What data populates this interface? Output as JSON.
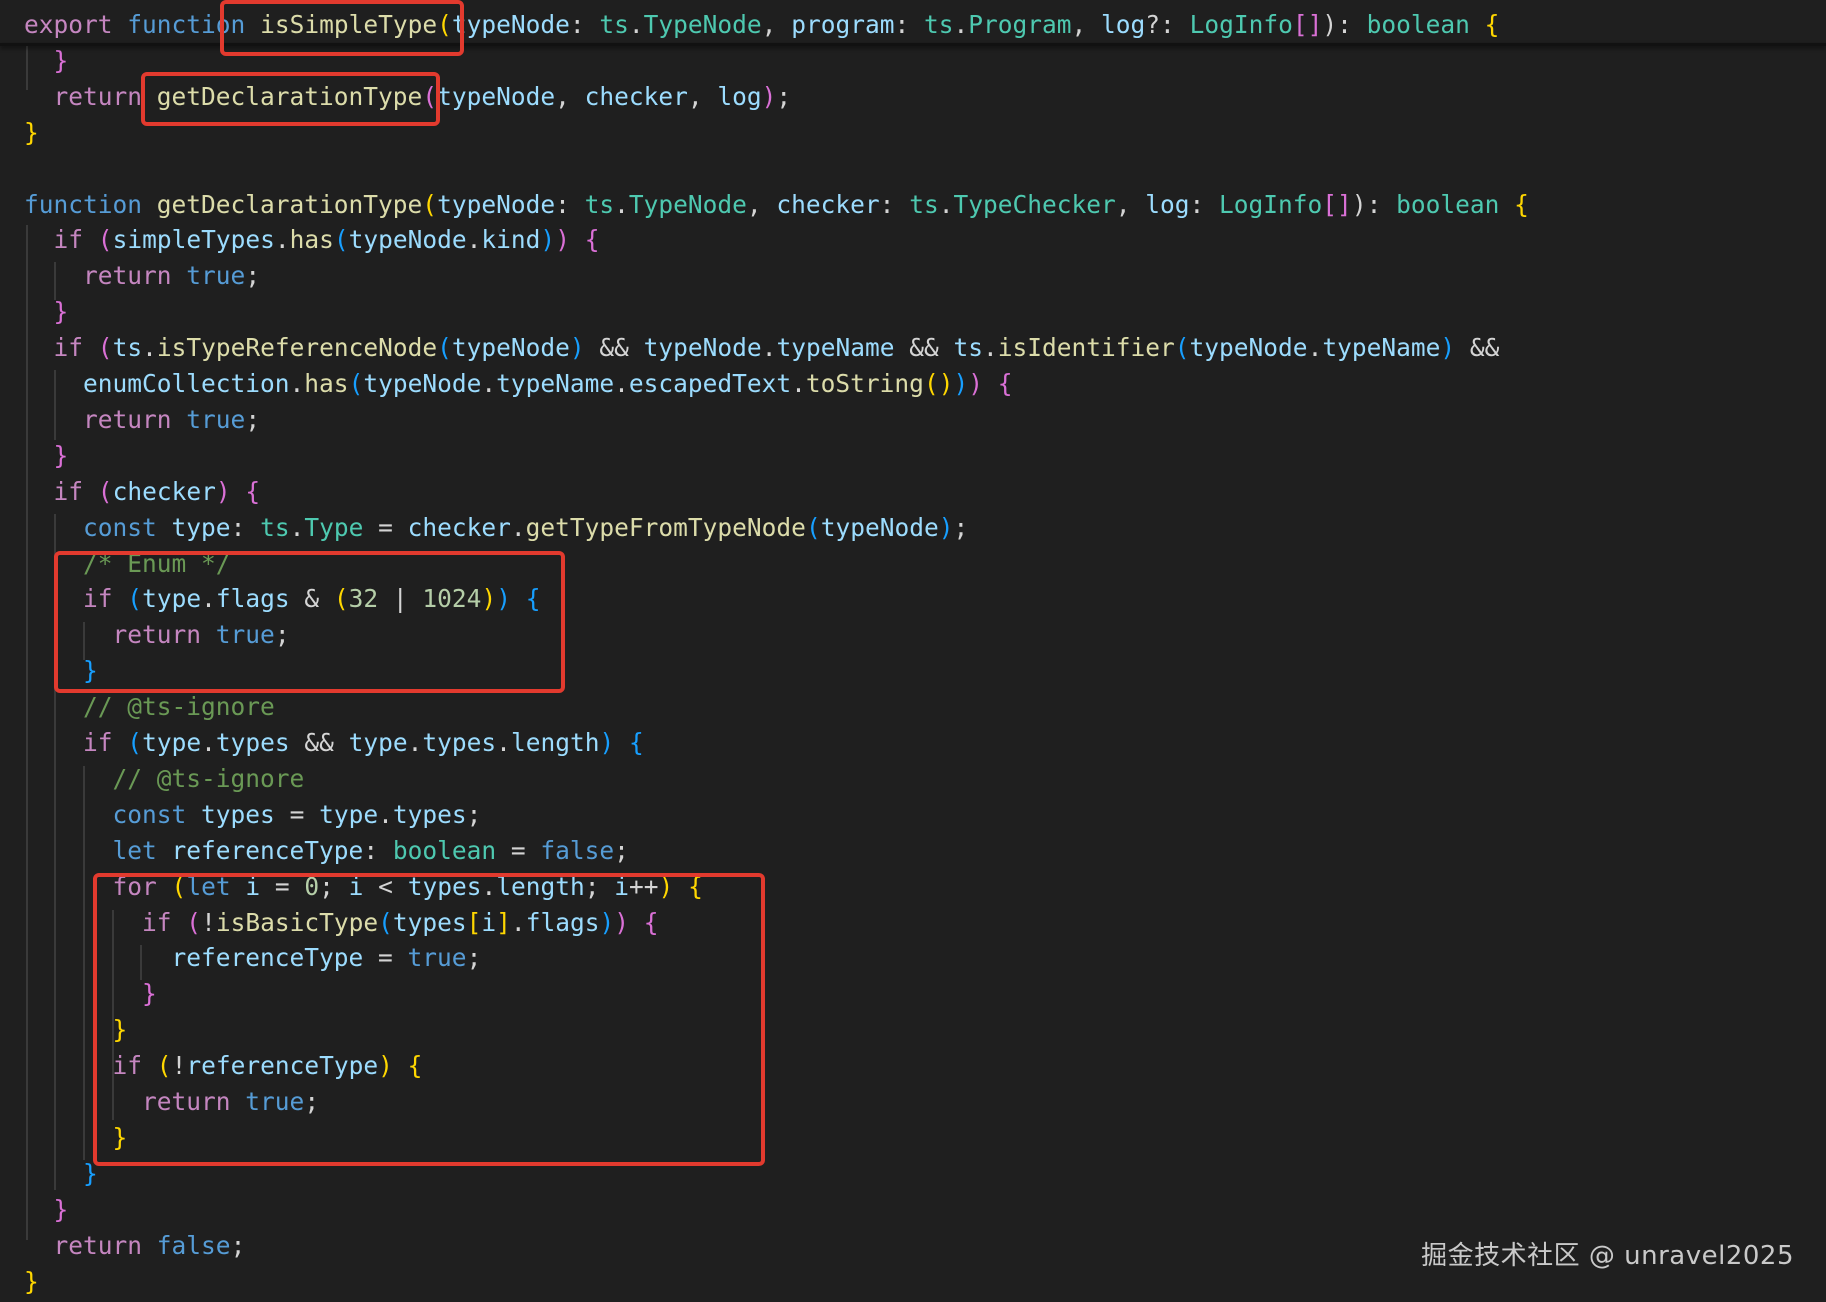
{
  "colors": {
    "background": "#1f1f1f",
    "keyword": "#569cd6",
    "control": "#c586c0",
    "function": "#dcdcaa",
    "variable": "#9cdcfe",
    "type": "#4ec9b0",
    "number": "#b5cea8",
    "comment": "#6a9955",
    "plain": "#d4d4d4",
    "bracket_gold": "#ffd700",
    "bracket_purple": "#da70d6",
    "bracket_blue": "#179fff",
    "highlight_box": "#e23a2e"
  },
  "code_lines": [
    {
      "tokens": [
        [
          "export",
          "control"
        ],
        [
          " ",
          "plain"
        ],
        [
          "function",
          "keyword"
        ],
        [
          " ",
          "plain"
        ],
        [
          "isSimpleType",
          "function"
        ],
        [
          "(",
          "bracket_gold"
        ],
        [
          "typeNode",
          "variable"
        ],
        [
          ": ",
          "plain"
        ],
        [
          "ts",
          "type"
        ],
        [
          ".",
          "plain"
        ],
        [
          "TypeNode",
          "type"
        ],
        [
          ", ",
          "plain"
        ],
        [
          "program",
          "variable"
        ],
        [
          ": ",
          "plain"
        ],
        [
          "ts",
          "type"
        ],
        [
          ".",
          "plain"
        ],
        [
          "Program",
          "type"
        ],
        [
          ", ",
          "plain"
        ],
        [
          "log",
          "variable"
        ],
        [
          "?: ",
          "plain"
        ],
        [
          "LogInfo",
          "type"
        ],
        [
          "[]",
          "bracket_purple"
        ],
        [
          "): ",
          "plain"
        ],
        [
          "boolean",
          "type"
        ],
        [
          " ",
          "plain"
        ],
        [
          "{",
          "bracket_gold"
        ]
      ]
    },
    {
      "tokens": [
        [
          "  ",
          "plain"
        ],
        [
          "}",
          "bracket_purple"
        ]
      ]
    },
    {
      "tokens": [
        [
          "  ",
          "plain"
        ],
        [
          "return",
          "control"
        ],
        [
          " ",
          "plain"
        ],
        [
          "getDeclarationType",
          "function"
        ],
        [
          "(",
          "bracket_purple"
        ],
        [
          "typeNode",
          "variable"
        ],
        [
          ", ",
          "plain"
        ],
        [
          "checker",
          "variable"
        ],
        [
          ", ",
          "plain"
        ],
        [
          "log",
          "variable"
        ],
        [
          ")",
          "bracket_purple"
        ],
        [
          ";",
          "plain"
        ]
      ]
    },
    {
      "tokens": [
        [
          "}",
          "bracket_gold"
        ]
      ]
    },
    {
      "tokens": []
    },
    {
      "tokens": [
        [
          "function",
          "keyword"
        ],
        [
          " ",
          "plain"
        ],
        [
          "getDeclarationType",
          "function"
        ],
        [
          "(",
          "bracket_gold"
        ],
        [
          "typeNode",
          "variable"
        ],
        [
          ": ",
          "plain"
        ],
        [
          "ts",
          "type"
        ],
        [
          ".",
          "plain"
        ],
        [
          "TypeNode",
          "type"
        ],
        [
          ", ",
          "plain"
        ],
        [
          "checker",
          "variable"
        ],
        [
          ": ",
          "plain"
        ],
        [
          "ts",
          "type"
        ],
        [
          ".",
          "plain"
        ],
        [
          "TypeChecker",
          "type"
        ],
        [
          ", ",
          "plain"
        ],
        [
          "log",
          "variable"
        ],
        [
          ": ",
          "plain"
        ],
        [
          "LogInfo",
          "type"
        ],
        [
          "[]",
          "bracket_purple"
        ],
        [
          "): ",
          "plain"
        ],
        [
          "boolean",
          "type"
        ],
        [
          " ",
          "plain"
        ],
        [
          "{",
          "bracket_gold"
        ]
      ]
    },
    {
      "tokens": [
        [
          "  ",
          "plain"
        ],
        [
          "if",
          "control"
        ],
        [
          " ",
          "plain"
        ],
        [
          "(",
          "bracket_purple"
        ],
        [
          "simpleTypes",
          "variable"
        ],
        [
          ".",
          "plain"
        ],
        [
          "has",
          "function"
        ],
        [
          "(",
          "bracket_blue"
        ],
        [
          "typeNode",
          "variable"
        ],
        [
          ".",
          "plain"
        ],
        [
          "kind",
          "variable"
        ],
        [
          ")",
          "bracket_blue"
        ],
        [
          ")",
          "bracket_purple"
        ],
        [
          " ",
          "plain"
        ],
        [
          "{",
          "bracket_purple"
        ]
      ]
    },
    {
      "tokens": [
        [
          "    ",
          "plain"
        ],
        [
          "return",
          "control"
        ],
        [
          " ",
          "plain"
        ],
        [
          "true",
          "keyword"
        ],
        [
          ";",
          "plain"
        ]
      ]
    },
    {
      "tokens": [
        [
          "  ",
          "plain"
        ],
        [
          "}",
          "bracket_purple"
        ]
      ]
    },
    {
      "tokens": [
        [
          "  ",
          "plain"
        ],
        [
          "if",
          "control"
        ],
        [
          " ",
          "plain"
        ],
        [
          "(",
          "bracket_purple"
        ],
        [
          "ts",
          "variable"
        ],
        [
          ".",
          "plain"
        ],
        [
          "isTypeReferenceNode",
          "function"
        ],
        [
          "(",
          "bracket_blue"
        ],
        [
          "typeNode",
          "variable"
        ],
        [
          ")",
          "bracket_blue"
        ],
        [
          " && ",
          "plain"
        ],
        [
          "typeNode",
          "variable"
        ],
        [
          ".",
          "plain"
        ],
        [
          "typeName",
          "variable"
        ],
        [
          " && ",
          "plain"
        ],
        [
          "ts",
          "variable"
        ],
        [
          ".",
          "plain"
        ],
        [
          "isIdentifier",
          "function"
        ],
        [
          "(",
          "bracket_blue"
        ],
        [
          "typeNode",
          "variable"
        ],
        [
          ".",
          "plain"
        ],
        [
          "typeName",
          "variable"
        ],
        [
          ")",
          "bracket_blue"
        ],
        [
          " &&",
          "plain"
        ]
      ]
    },
    {
      "tokens": [
        [
          "    ",
          "plain"
        ],
        [
          "enumCollection",
          "variable"
        ],
        [
          ".",
          "plain"
        ],
        [
          "has",
          "function"
        ],
        [
          "(",
          "bracket_blue"
        ],
        [
          "typeNode",
          "variable"
        ],
        [
          ".",
          "plain"
        ],
        [
          "typeName",
          "variable"
        ],
        [
          ".",
          "plain"
        ],
        [
          "escapedText",
          "variable"
        ],
        [
          ".",
          "plain"
        ],
        [
          "toString",
          "function"
        ],
        [
          "()",
          "bracket_gold"
        ],
        [
          ")",
          "bracket_blue"
        ],
        [
          ")",
          "bracket_purple"
        ],
        [
          " ",
          "plain"
        ],
        [
          "{",
          "bracket_purple"
        ]
      ]
    },
    {
      "tokens": [
        [
          "    ",
          "plain"
        ],
        [
          "return",
          "control"
        ],
        [
          " ",
          "plain"
        ],
        [
          "true",
          "keyword"
        ],
        [
          ";",
          "plain"
        ]
      ]
    },
    {
      "tokens": [
        [
          "  ",
          "plain"
        ],
        [
          "}",
          "bracket_purple"
        ]
      ]
    },
    {
      "tokens": [
        [
          "  ",
          "plain"
        ],
        [
          "if",
          "control"
        ],
        [
          " ",
          "plain"
        ],
        [
          "(",
          "bracket_purple"
        ],
        [
          "checker",
          "variable"
        ],
        [
          ")",
          "bracket_purple"
        ],
        [
          " ",
          "plain"
        ],
        [
          "{",
          "bracket_purple"
        ]
      ]
    },
    {
      "tokens": [
        [
          "    ",
          "plain"
        ],
        [
          "const",
          "keyword"
        ],
        [
          " ",
          "plain"
        ],
        [
          "type",
          "variable"
        ],
        [
          ": ",
          "plain"
        ],
        [
          "ts",
          "type"
        ],
        [
          ".",
          "plain"
        ],
        [
          "Type",
          "type"
        ],
        [
          " = ",
          "plain"
        ],
        [
          "checker",
          "variable"
        ],
        [
          ".",
          "plain"
        ],
        [
          "getTypeFromTypeNode",
          "function"
        ],
        [
          "(",
          "bracket_blue"
        ],
        [
          "typeNode",
          "variable"
        ],
        [
          ")",
          "bracket_blue"
        ],
        [
          ";",
          "plain"
        ]
      ]
    },
    {
      "tokens": [
        [
          "    ",
          "plain"
        ],
        [
          "/* Enum */",
          "comment"
        ]
      ]
    },
    {
      "tokens": [
        [
          "    ",
          "plain"
        ],
        [
          "if",
          "control"
        ],
        [
          " ",
          "plain"
        ],
        [
          "(",
          "bracket_blue"
        ],
        [
          "type",
          "variable"
        ],
        [
          ".",
          "plain"
        ],
        [
          "flags",
          "variable"
        ],
        [
          " & ",
          "plain"
        ],
        [
          "(",
          "bracket_gold"
        ],
        [
          "32",
          "number"
        ],
        [
          " | ",
          "plain"
        ],
        [
          "1024",
          "number"
        ],
        [
          ")",
          "bracket_gold"
        ],
        [
          ")",
          "bracket_blue"
        ],
        [
          " ",
          "plain"
        ],
        [
          "{",
          "bracket_blue"
        ]
      ]
    },
    {
      "tokens": [
        [
          "      ",
          "plain"
        ],
        [
          "return",
          "control"
        ],
        [
          " ",
          "plain"
        ],
        [
          "true",
          "keyword"
        ],
        [
          ";",
          "plain"
        ]
      ]
    },
    {
      "tokens": [
        [
          "    ",
          "plain"
        ],
        [
          "}",
          "bracket_blue"
        ]
      ]
    },
    {
      "tokens": [
        [
          "    ",
          "plain"
        ],
        [
          "// @ts-ignore",
          "comment"
        ]
      ]
    },
    {
      "tokens": [
        [
          "    ",
          "plain"
        ],
        [
          "if",
          "control"
        ],
        [
          " ",
          "plain"
        ],
        [
          "(",
          "bracket_blue"
        ],
        [
          "type",
          "variable"
        ],
        [
          ".",
          "plain"
        ],
        [
          "types",
          "variable"
        ],
        [
          " && ",
          "plain"
        ],
        [
          "type",
          "variable"
        ],
        [
          ".",
          "plain"
        ],
        [
          "types",
          "variable"
        ],
        [
          ".",
          "plain"
        ],
        [
          "length",
          "variable"
        ],
        [
          ")",
          "bracket_blue"
        ],
        [
          " ",
          "plain"
        ],
        [
          "{",
          "bracket_blue"
        ]
      ]
    },
    {
      "tokens": [
        [
          "      ",
          "plain"
        ],
        [
          "// @ts-ignore",
          "comment"
        ]
      ]
    },
    {
      "tokens": [
        [
          "      ",
          "plain"
        ],
        [
          "const",
          "keyword"
        ],
        [
          " ",
          "plain"
        ],
        [
          "types",
          "variable"
        ],
        [
          " = ",
          "plain"
        ],
        [
          "type",
          "variable"
        ],
        [
          ".",
          "plain"
        ],
        [
          "types",
          "variable"
        ],
        [
          ";",
          "plain"
        ]
      ]
    },
    {
      "tokens": [
        [
          "      ",
          "plain"
        ],
        [
          "let",
          "keyword"
        ],
        [
          " ",
          "plain"
        ],
        [
          "referenceType",
          "variable"
        ],
        [
          ": ",
          "plain"
        ],
        [
          "boolean",
          "type"
        ],
        [
          " = ",
          "plain"
        ],
        [
          "false",
          "keyword"
        ],
        [
          ";",
          "plain"
        ]
      ]
    },
    {
      "tokens": [
        [
          "      ",
          "plain"
        ],
        [
          "for",
          "control"
        ],
        [
          " ",
          "plain"
        ],
        [
          "(",
          "bracket_gold"
        ],
        [
          "let",
          "keyword"
        ],
        [
          " ",
          "plain"
        ],
        [
          "i",
          "variable"
        ],
        [
          " = ",
          "plain"
        ],
        [
          "0",
          "number"
        ],
        [
          "; ",
          "plain"
        ],
        [
          "i",
          "variable"
        ],
        [
          " < ",
          "plain"
        ],
        [
          "types",
          "variable"
        ],
        [
          ".",
          "plain"
        ],
        [
          "length",
          "variable"
        ],
        [
          "; ",
          "plain"
        ],
        [
          "i",
          "variable"
        ],
        [
          "++",
          "plain"
        ],
        [
          ")",
          "bracket_gold"
        ],
        [
          " ",
          "plain"
        ],
        [
          "{",
          "bracket_gold"
        ]
      ]
    },
    {
      "tokens": [
        [
          "        ",
          "plain"
        ],
        [
          "if",
          "control"
        ],
        [
          " ",
          "plain"
        ],
        [
          "(",
          "bracket_purple"
        ],
        [
          "!",
          "plain"
        ],
        [
          "isBasicType",
          "function"
        ],
        [
          "(",
          "bracket_blue"
        ],
        [
          "types",
          "variable"
        ],
        [
          "[",
          "bracket_gold"
        ],
        [
          "i",
          "variable"
        ],
        [
          "]",
          "bracket_gold"
        ],
        [
          ".",
          "plain"
        ],
        [
          "flags",
          "variable"
        ],
        [
          ")",
          "bracket_blue"
        ],
        [
          ")",
          "bracket_purple"
        ],
        [
          " ",
          "plain"
        ],
        [
          "{",
          "bracket_purple"
        ]
      ]
    },
    {
      "tokens": [
        [
          "          ",
          "plain"
        ],
        [
          "referenceType",
          "variable"
        ],
        [
          " = ",
          "plain"
        ],
        [
          "true",
          "keyword"
        ],
        [
          ";",
          "plain"
        ]
      ]
    },
    {
      "tokens": [
        [
          "        ",
          "plain"
        ],
        [
          "}",
          "bracket_purple"
        ]
      ]
    },
    {
      "tokens": [
        [
          "      ",
          "plain"
        ],
        [
          "}",
          "bracket_gold"
        ]
      ]
    },
    {
      "tokens": [
        [
          "      ",
          "plain"
        ],
        [
          "if",
          "control"
        ],
        [
          " ",
          "plain"
        ],
        [
          "(",
          "bracket_gold"
        ],
        [
          "!",
          "plain"
        ],
        [
          "referenceType",
          "variable"
        ],
        [
          ")",
          "bracket_gold"
        ],
        [
          " ",
          "plain"
        ],
        [
          "{",
          "bracket_gold"
        ]
      ]
    },
    {
      "tokens": [
        [
          "        ",
          "plain"
        ],
        [
          "return",
          "control"
        ],
        [
          " ",
          "plain"
        ],
        [
          "true",
          "keyword"
        ],
        [
          ";",
          "plain"
        ]
      ]
    },
    {
      "tokens": [
        [
          "      ",
          "plain"
        ],
        [
          "}",
          "bracket_gold"
        ]
      ]
    },
    {
      "tokens": [
        [
          "    ",
          "plain"
        ],
        [
          "}",
          "bracket_blue"
        ]
      ]
    },
    {
      "tokens": [
        [
          "  ",
          "plain"
        ],
        [
          "}",
          "bracket_purple"
        ]
      ]
    },
    {
      "tokens": [
        [
          "  ",
          "plain"
        ],
        [
          "return",
          "control"
        ],
        [
          " ",
          "plain"
        ],
        [
          "false",
          "keyword"
        ],
        [
          ";",
          "plain"
        ]
      ]
    },
    {
      "tokens": [
        [
          "}",
          "bracket_gold"
        ]
      ]
    }
  ],
  "watermark": "掘金技术社区 @ unravel2025"
}
